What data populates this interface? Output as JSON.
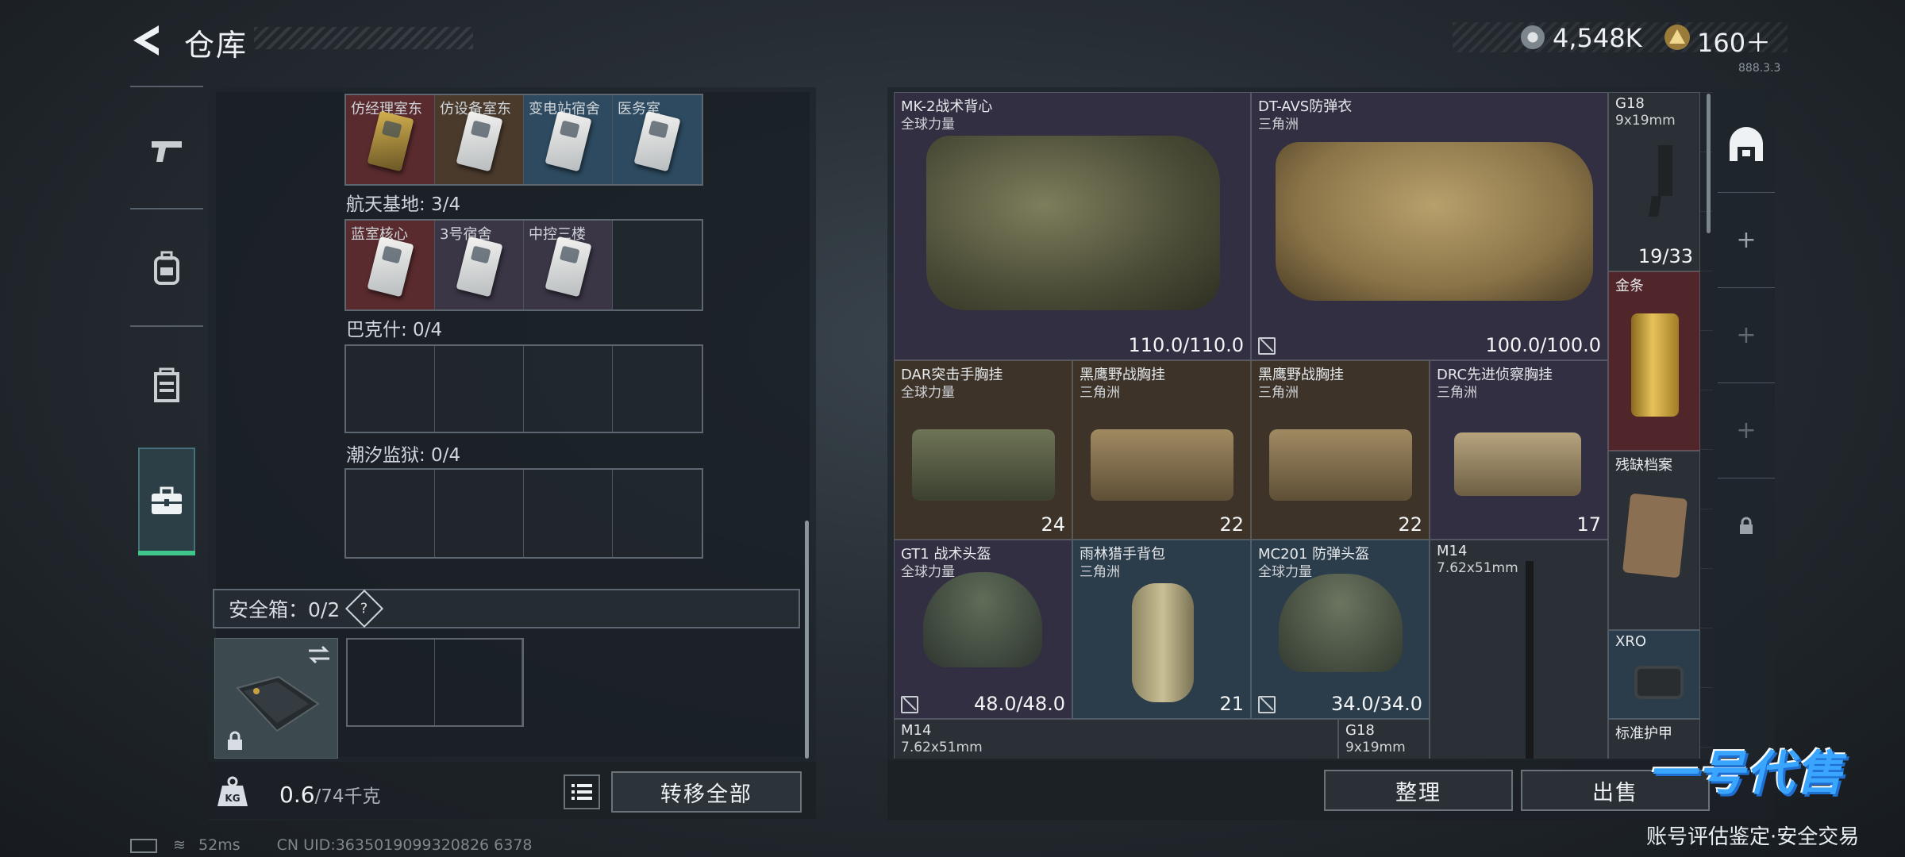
{
  "header": {
    "title": "仓库",
    "currency1_value": "4,548K",
    "currency2_value": "160＋",
    "version_text": "888.3.3"
  },
  "nav": {
    "items": [
      {
        "icon": "pistol-icon"
      },
      {
        "icon": "backpack-icon"
      },
      {
        "icon": "armor-icon"
      },
      {
        "icon": "toolbox-icon",
        "active": true
      }
    ]
  },
  "left": {
    "sections": [
      {
        "label": "",
        "keys": [
          {
            "name": "仿经理室东",
            "color": "red"
          },
          {
            "name": "仿设备室东",
            "color": "brown"
          },
          {
            "name": "变电站宿舍",
            "color": "blue"
          },
          {
            "name": "医务室",
            "color": "blue"
          }
        ]
      },
      {
        "label": "航天基地: 3/4",
        "keys": [
          {
            "name": "蓝室核心",
            "color": "red"
          },
          {
            "name": "3号宿舍",
            "color": "purple"
          },
          {
            "name": "中控三楼",
            "color": "purple"
          }
        ]
      },
      {
        "label": "巴克什: 0/4",
        "keys": []
      },
      {
        "label": "潮汐监狱: 0/4",
        "keys": []
      }
    ],
    "safe_box": {
      "label": "安全箱：0/2",
      "help": "?"
    },
    "weight": {
      "current": "0.6",
      "capacity": "/74千克",
      "icon_label": "KG"
    },
    "transfer_all": "转移全部",
    "status": {
      "ping": "52ms",
      "uid": "CN UID:3635019099320826 6378"
    }
  },
  "stash": {
    "items": [
      {
        "name": "MK-2战术背心",
        "sub": "全球力量",
        "value": "110.0/110.0",
        "color": "purple"
      },
      {
        "name": "DT-AVS防弹衣",
        "sub": "三角洲",
        "value": "100.0/100.0",
        "color": "purple"
      },
      {
        "name": "G18",
        "sub": "9x19mm",
        "value": "19/33",
        "color": "grey"
      },
      {
        "name": "金条",
        "sub": "",
        "value": "",
        "color": "red"
      },
      {
        "name": "DAR突击手胸挂",
        "sub": "全球力量",
        "value": "24",
        "color": "brown"
      },
      {
        "name": "黑鹰野战胸挂",
        "sub": "三角洲",
        "value": "22",
        "color": "brown"
      },
      {
        "name": "黑鹰野战胸挂",
        "sub": "三角洲",
        "value": "22",
        "color": "brown"
      },
      {
        "name": "DRC先进侦察胸挂",
        "sub": "三角洲",
        "value": "17",
        "color": "purple"
      },
      {
        "name": "残缺档案",
        "sub": "",
        "value": "",
        "color": "grey"
      },
      {
        "name": "GT1 战术头盔",
        "sub": "全球力量",
        "value": "48.0/48.0",
        "color": "purple"
      },
      {
        "name": "雨林猎手背包",
        "sub": "三角洲",
        "value": "21",
        "color": "steel"
      },
      {
        "name": "MC201 防弹头盔",
        "sub": "全球力量",
        "value": "34.0/34.0",
        "color": "steel"
      },
      {
        "name": "M14",
        "sub": "7.62x51mm",
        "value": "",
        "color": "grey"
      },
      {
        "name": "XRO",
        "sub": "",
        "value": "",
        "color": "steel"
      },
      {
        "name": "M14",
        "sub": "7.62x51mm",
        "value": "",
        "color": "grey"
      },
      {
        "name": "G18",
        "sub": "9x19mm",
        "value": "",
        "color": "grey"
      },
      {
        "name": "标准护甲",
        "sub": "",
        "value": "",
        "color": "grey"
      }
    ],
    "sort_button": "整理",
    "sell_button": "出售"
  },
  "rail": {
    "add": "+"
  },
  "watermark": {
    "logo": "一号代售",
    "sub": "账号评估鉴定·安全交易"
  }
}
